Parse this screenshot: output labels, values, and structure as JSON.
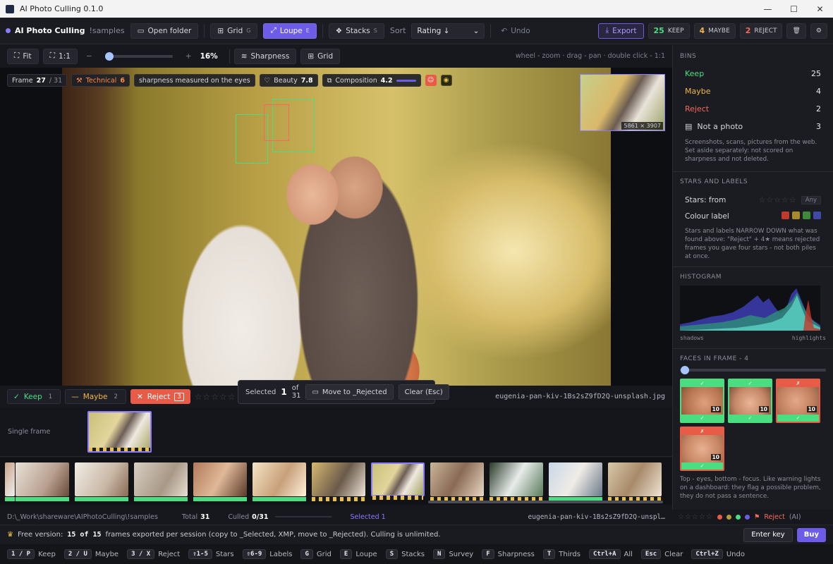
{
  "window": {
    "title": "AI Photo Culling 0.1.0",
    "min": "—",
    "max": "☐",
    "close": "✕"
  },
  "toolbar": {
    "brand": "AI Photo Culling",
    "folder": "!samples",
    "open_folder": "Open folder",
    "grid": "Grid",
    "grid_key": "G",
    "loupe": "Loupe",
    "loupe_key": "E",
    "stacks": "Stacks",
    "stacks_key": "S",
    "sort_label": "Sort",
    "sort_value": "Rating ↓",
    "undo": "Undo",
    "export": "Export",
    "keep_count": "25",
    "keep_label": "KEEP",
    "maybe_count": "4",
    "maybe_label": "MAYBE",
    "reject_count": "2",
    "reject_label": "REJECT"
  },
  "viewbar": {
    "fit": "Fit",
    "one_to_one": "1:1",
    "zoom_minus": "−",
    "zoom_plus": "+",
    "zoom": "16%",
    "zoom_fraction": 0.0,
    "sharpness": "Sharpness",
    "grid": "Grid",
    "hint": "wheel - zoom · drag - pan · double click - 1:1"
  },
  "overlay": {
    "frame_label": "Frame",
    "frame_num": "27",
    "frame_total": "/ 31",
    "technical_label": "Technical",
    "technical_value": "6",
    "sharp_note": "sharpness measured on the eyes",
    "beauty_label": "Beauty",
    "beauty_value": "7.8",
    "composition_label": "Composition",
    "composition_value": "4.2",
    "image_size": "5861 × 3907"
  },
  "actions": {
    "keep": "Keep",
    "keep_n": "1",
    "maybe": "Maybe",
    "maybe_n": "2",
    "reject": "Reject",
    "reject_n": "3",
    "stars": "☆☆☆☆☆",
    "filename": "eugenia-pan-kiv-1Bs2sZ9fD2Q-unsplash.jpg"
  },
  "selection": {
    "selected_label": "Selected",
    "selected_num": "1",
    "of_total": "of 31",
    "move": "Move to _Rejected",
    "clear": "Clear (Esc)"
  },
  "single": {
    "label": "Single frame"
  },
  "status": {
    "path": "D:\\_Work\\shareware\\AIPhotoCulling\\!samples",
    "total_label": "Total",
    "total": "31",
    "culled_label": "Culled",
    "culled": "0/31",
    "selected": "Selected 1",
    "file": "eugenia-pan-kiv-1Bs2sZ9fD2Q-unspl…",
    "reject_tag": "Reject",
    "reject_ai": "(AI)"
  },
  "freebar": {
    "text_a": "Free version:",
    "quota": "15 of 15",
    "text_b": "frames exported per session (copy to _Selected, XMP, move to _Rejected). Culling is unlimited.",
    "enter_key": "Enter key",
    "buy": "Buy"
  },
  "shortcuts": [
    {
      "key": "1 / P",
      "label": "Keep"
    },
    {
      "key": "2 / U",
      "label": "Maybe"
    },
    {
      "key": "3 / X",
      "label": "Reject"
    },
    {
      "key": "⇧1-5",
      "label": "Stars"
    },
    {
      "key": "⇧6-9",
      "label": "Labels"
    },
    {
      "key": "G",
      "label": "Grid"
    },
    {
      "key": "E",
      "label": "Loupe"
    },
    {
      "key": "S",
      "label": "Stacks"
    },
    {
      "key": "N",
      "label": "Survey"
    },
    {
      "key": "F",
      "label": "Sharpness"
    },
    {
      "key": "T",
      "label": "Thirds"
    },
    {
      "key": "Ctrl+A",
      "label": "All"
    },
    {
      "key": "Esc",
      "label": "Clear"
    },
    {
      "key": "Ctrl+Z",
      "label": "Undo"
    }
  ],
  "panel": {
    "bins_title": "BINS",
    "bins": [
      {
        "label": "Keep",
        "count": "25",
        "color": "#4ade80"
      },
      {
        "label": "Maybe",
        "count": "4",
        "color": "#f0b54a"
      },
      {
        "label": "Reject",
        "count": "2",
        "color": "#f26b5b"
      }
    ],
    "not_photo": "Not a photo",
    "not_photo_count": "3",
    "not_photo_desc": "Screenshots, scans, pictures from the web. Set aside separately: not scored on sharpness and not deleted.",
    "stars_title": "STARS AND LABELS",
    "stars_from": "Stars: from",
    "stars_any": "Any",
    "colour_label": "Colour label",
    "stars_desc": "Stars and labels NARROW DOWN what was found above: \"Reject\" + 4★ means rejected frames you gave four stars - not both piles at once.",
    "histogram_title": "HISTOGRAM",
    "shadows": "shadows",
    "highlights": "highlights",
    "faces_title": "FACES IN FRAME - 4",
    "faces": [
      {
        "top": "✓",
        "bottom": "✓",
        "score": "10",
        "state": "keep"
      },
      {
        "top": "✓",
        "bottom": "✓",
        "score": "10",
        "state": "keep"
      },
      {
        "top": "✗",
        "bottom": "✓",
        "score": "10",
        "state": "reject"
      },
      {
        "top": "✗",
        "bottom": "✓",
        "score": "10",
        "state": "reject"
      }
    ],
    "faces_desc": "Top - eyes, bottom - focus. Like warning lights on a dashboard: they flag a possible problem, they do not pass a sentence."
  },
  "colors": {
    "accent": "#6c5ce7",
    "keep": "#4ade80",
    "maybe": "#f0b54a",
    "reject": "#e85b47"
  }
}
